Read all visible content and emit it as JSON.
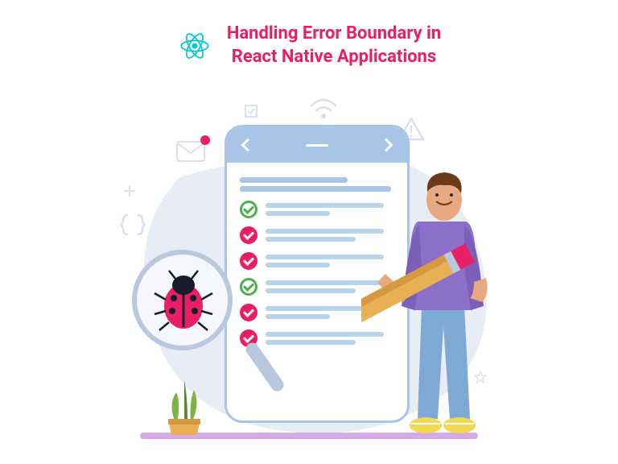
{
  "title": {
    "line1": "Handling Error Boundary in",
    "line2": "React Native Applications"
  },
  "checklist": [
    {
      "style": "green"
    },
    {
      "style": "pink"
    },
    {
      "style": "pink"
    },
    {
      "style": "green"
    },
    {
      "style": "pink"
    },
    {
      "style": "pink"
    }
  ],
  "colors": {
    "brand_pink": "#e91e63",
    "react_cyan": "#00c8d7",
    "phone_blue": "#a8c5e8",
    "bg_blob": "#e8ecf5"
  }
}
